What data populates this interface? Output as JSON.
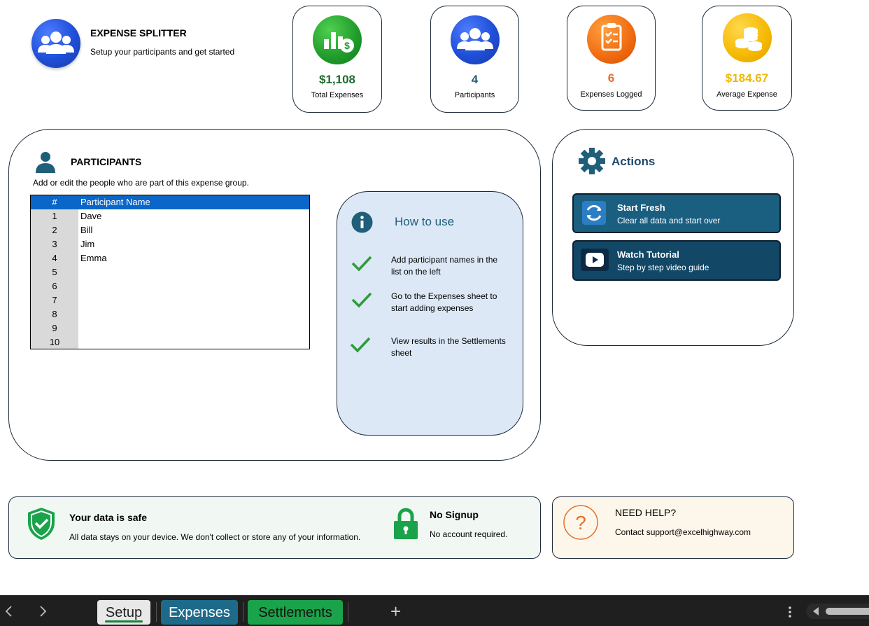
{
  "header": {
    "title": "EXPENSE SPLITTER",
    "subtitle": "Setup your participants and get started",
    "logo_icon": "group-icon"
  },
  "stats": [
    {
      "value": "$1,108",
      "label": "Total Expenses",
      "icon": "chart-dollar-icon",
      "color": "#1f6b2f"
    },
    {
      "value": "4",
      "label": "Participants",
      "icon": "group-icon",
      "color": "#1f5f7a"
    },
    {
      "value": "6",
      "label": "Expenses Logged",
      "icon": "clipboard-icon",
      "color": "#e3702a"
    },
    {
      "value": "$184.67",
      "label": "Average Expense",
      "icon": "coins-icon",
      "color": "#f2b800"
    }
  ],
  "participants": {
    "title": "PARTICIPANTS",
    "description": "Add or edit the people who are part of this expense group.",
    "table_headers": [
      "#",
      "Participant Name"
    ],
    "rows": [
      {
        "num": "1",
        "name": "Dave"
      },
      {
        "num": "2",
        "name": "Bill"
      },
      {
        "num": "3",
        "name": "Jim"
      },
      {
        "num": "4",
        "name": "Emma"
      },
      {
        "num": "5",
        "name": ""
      },
      {
        "num": "6",
        "name": ""
      },
      {
        "num": "7",
        "name": ""
      },
      {
        "num": "8",
        "name": ""
      },
      {
        "num": "9",
        "name": ""
      },
      {
        "num": "10",
        "name": ""
      }
    ]
  },
  "how_to": {
    "title": "How to use",
    "steps": [
      "Add participant names in the list on the left",
      "Go to the Expenses sheet to start adding expenses",
      "View results in the Settlements sheet"
    ]
  },
  "actions": {
    "title": "Actions",
    "buttons": [
      {
        "title": "Start Fresh",
        "subtitle": "Clear all data and start over",
        "icon": "refresh-icon"
      },
      {
        "title": "Watch Tutorial",
        "subtitle": "Step by step video guide",
        "icon": "play-icon"
      }
    ]
  },
  "footer": {
    "safe_title": "Your data is safe",
    "safe_text": "All data stays on your device. We don't collect or store any of your information.",
    "nosignup_title": "No Signup",
    "nosignup_text": "No account required.",
    "help_title": "NEED HELP?",
    "help_text": "Contact support@excelhighway.com"
  },
  "sheets": {
    "tabs": [
      "Setup",
      "Expenses",
      "Settlements"
    ],
    "active": "Setup",
    "add_label": "+"
  },
  "colors": {
    "accent_dark": "#1b5f80",
    "table_header": "#0a66c8",
    "expenses_tab": "#1e6a8a",
    "settlements_tab": "#1aa34a"
  }
}
